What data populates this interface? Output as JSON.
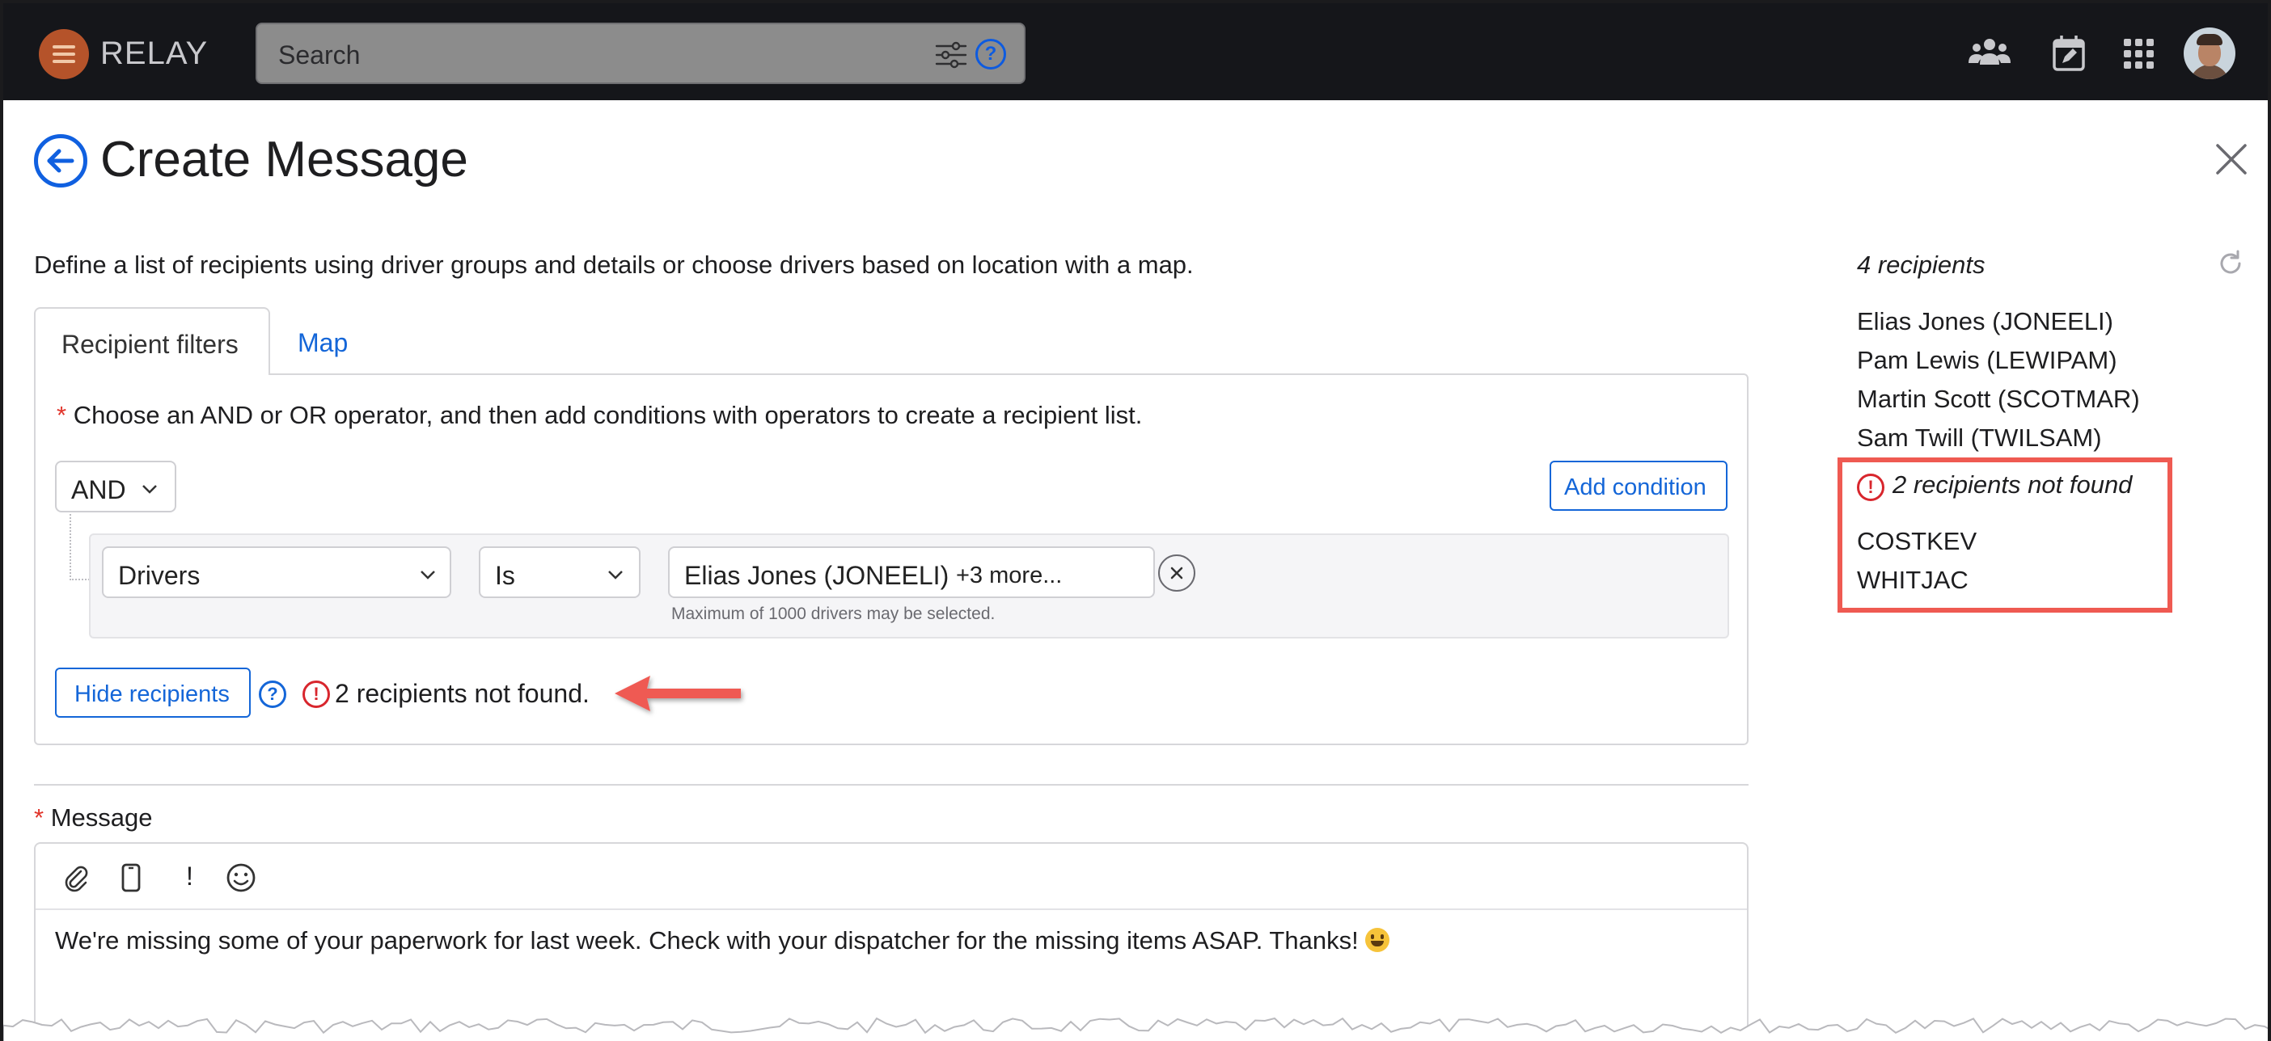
{
  "app": {
    "brand": "RELAY"
  },
  "search": {
    "placeholder": "Search"
  },
  "header": {
    "title": "Create Message"
  },
  "intro": "Define a list of recipients using driver groups and details or choose drivers based on location with a map.",
  "tabs": [
    {
      "label": "Recipient filters",
      "active": true
    },
    {
      "label": "Map",
      "active": false
    }
  ],
  "filters": {
    "required_mark": "*",
    "instruction": "Choose an AND or OR operator, and then add conditions with operators to create a recipient list.",
    "operator": "AND",
    "add_condition_label": "Add condition",
    "condition": {
      "field": "Drivers",
      "comparator": "Is",
      "value": "Elias Jones (JONEELI)",
      "more": "+3 more...",
      "hint": "Maximum of 1000 drivers may be selected."
    },
    "hide_recipients_label": "Hide recipients",
    "help_glyph": "?",
    "warning_glyph": "!",
    "not_found_text": "2 recipients not found."
  },
  "message": {
    "required_mark": "*",
    "label": "Message",
    "toolbar": [
      {
        "icon": "paperclip-icon"
      },
      {
        "icon": "phone-icon"
      },
      {
        "icon": "exclamation-icon",
        "glyph": "!"
      },
      {
        "icon": "smiley-icon"
      }
    ],
    "body": "We're missing some of your paperwork for last week. Check with your dispatcher for the missing items ASAP. Thanks!"
  },
  "recipients": {
    "count_label": "4 recipients",
    "items": [
      "Elias Jones (JONEELI)",
      "Pam Lewis (LEWIPAM)",
      "Martin Scott (SCOTMAR)",
      "Sam Twill (TWILSAM)"
    ],
    "not_found": {
      "warning_glyph": "!",
      "heading": "2 recipients not found",
      "items": [
        "COSTKEV",
        "WHITJAC"
      ]
    }
  },
  "colors": {
    "topbar": "#15161a",
    "accent": "#1466d8",
    "warning": "#d8262d",
    "highlight": "#ef5a52"
  }
}
